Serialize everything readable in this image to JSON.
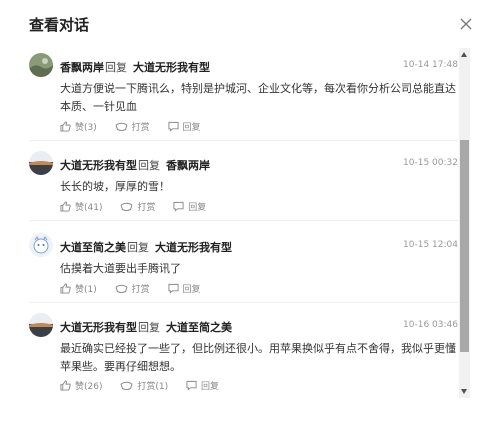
{
  "dialog": {
    "title": "查看对话"
  },
  "comments": [
    {
      "author": "香飘两岸",
      "reply_word": "回复",
      "target": "大道无形我有型",
      "time": "10-14 17:48",
      "text": "大道方便说一下腾讯么，特别是护城河、企业文化等，每次看你分析公司总能直达本质、一针见血",
      "like_label": "赞(3)",
      "reward_label": "打赏",
      "reply_label": "回复",
      "avatar_icon": "landscape-avatar"
    },
    {
      "author": "大道无形我有型",
      "reply_word": "回复",
      "target": "香飘两岸",
      "time": "10-15 00:32",
      "text": "长长的坡，厚厚的雪！",
      "like_label": "赞(41)",
      "reward_label": "打赏",
      "reply_label": "回复",
      "avatar_icon": "sunset-avatar"
    },
    {
      "author": "大道至简之美",
      "reply_word": "回复",
      "target": "大道无形我有型",
      "time": "10-15 12:04",
      "text": "估摸着大道要出手腾讯了",
      "like_label": "赞(1)",
      "reward_label": "打赏",
      "reply_label": "回复",
      "avatar_icon": "cartoon-avatar"
    },
    {
      "author": "大道无形我有型",
      "reply_word": "回复",
      "target": "大道至简之美",
      "time": "10-16 03:46",
      "text": "最近确实已经投了一些了，但比例还很小。用苹果换似乎有点不舍得，我似乎更懂苹果些。要再仔细想想。",
      "like_label": "赞(26)",
      "reward_label": "打赏(1)",
      "reply_label": "回复",
      "avatar_icon": "sunset-avatar"
    }
  ]
}
